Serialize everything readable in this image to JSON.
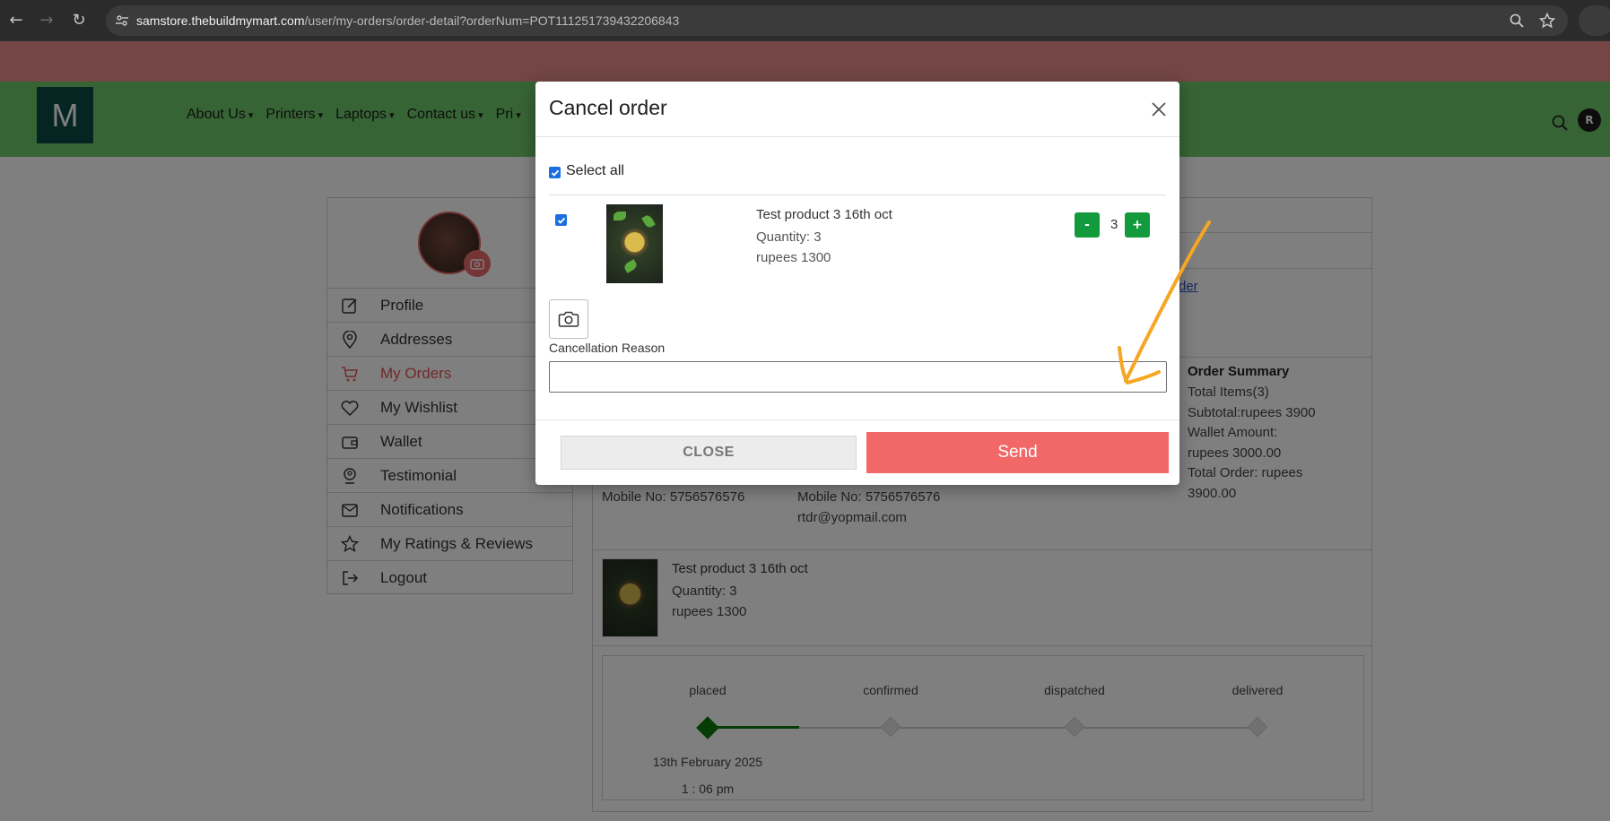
{
  "browser": {
    "url_host": "samstore.thebuildmymart.com",
    "url_path": "/user/my-orders/order-detail?orderNum=POT111251739432206843"
  },
  "site": {
    "logo_letter": "M",
    "nav": [
      "About Us",
      "Printers",
      "Laptops",
      "Contact us",
      "Pri"
    ],
    "user_initial": "R"
  },
  "sidebar": {
    "items": [
      {
        "label": "Profile",
        "icon": "edit-icon"
      },
      {
        "label": "Addresses",
        "icon": "location-pin-icon"
      },
      {
        "label": "My Orders",
        "icon": "cart-icon",
        "active": true
      },
      {
        "label": "My Wishlist",
        "icon": "heart-icon"
      },
      {
        "label": "Wallet",
        "icon": "wallet-icon"
      },
      {
        "label": "Testimonial",
        "icon": "testimonial-icon"
      },
      {
        "label": "Notifications",
        "icon": "mail-icon"
      },
      {
        "label": "My Ratings & Reviews",
        "icon": "star-icon"
      },
      {
        "label": "Logout",
        "icon": "logout-icon"
      }
    ]
  },
  "order": {
    "link_fragment": "rder",
    "summary": {
      "title": "Order Summary",
      "lines": [
        "Total Items(3)",
        "Subtotal:rupees 3900",
        "Wallet Amount:",
        "rupees 3000.00",
        "Total Order: rupees",
        "3900.00"
      ]
    },
    "billing_mobile": "Mobile No: 5756576576",
    "shipping_mobile": "Mobile No: 5756576576",
    "shipping_email": "rtdr@yopmail.com",
    "item": {
      "name": "Test product 3 16th oct",
      "quantity": "Quantity: 3",
      "price": "rupees 1300"
    },
    "timeline": {
      "steps": [
        "placed",
        "confirmed",
        "dispatched",
        "delivered"
      ],
      "date": "13th February 2025",
      "time": "1 : 06 pm"
    }
  },
  "modal": {
    "title": "Cancel order",
    "select_all_label": "Select all",
    "item": {
      "name": "Test product 3 16th oct",
      "quantity": "Quantity: 3",
      "price": "rupees 1300",
      "qty_value": "3"
    },
    "minus": "-",
    "plus": "+",
    "reason_label": "Cancellation Reason",
    "reason_value": "",
    "close_label": "CLOSE",
    "send_label": "Send"
  },
  "colors": {
    "header_green": "#4caf46",
    "send_red": "#f26868",
    "qty_green": "#139a3c",
    "annotation_orange": "#f5a623"
  }
}
